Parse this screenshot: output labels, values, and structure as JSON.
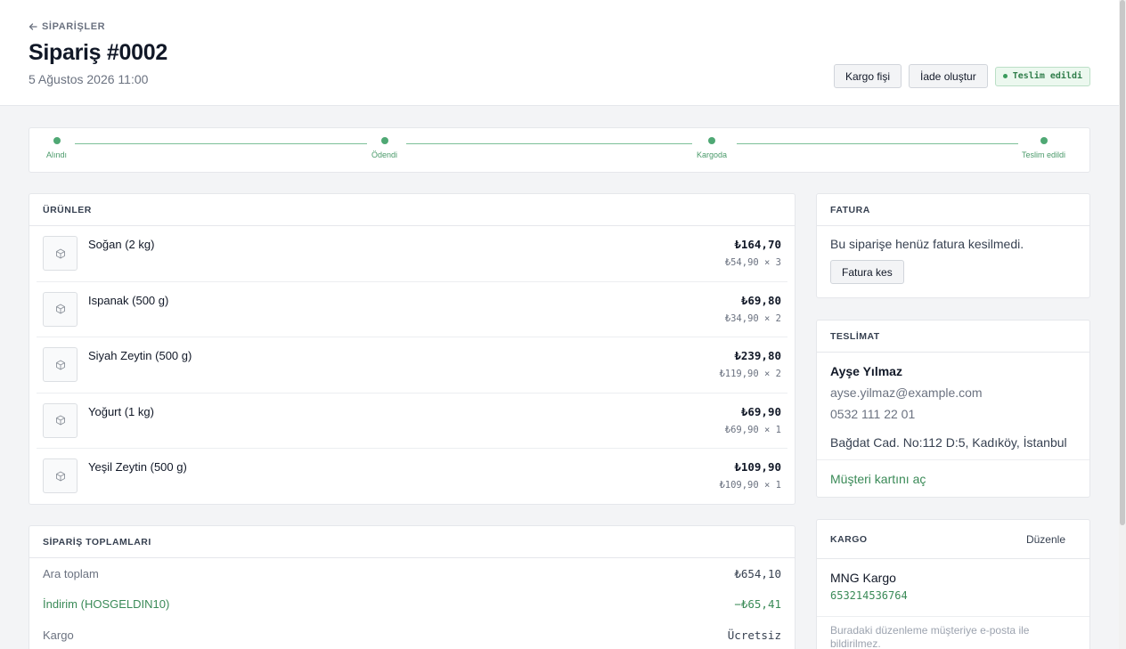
{
  "header": {
    "back_label": "SİPARİŞLER",
    "title": "Sipariş #0002",
    "date": "5 Ağustos 2026 11:00",
    "actions": {
      "shipping_slip": "Kargo fişi",
      "create_return": "İade oluştur"
    },
    "status": "Teslim edildi"
  },
  "progress": {
    "steps": [
      "Alındı",
      "Ödendi",
      "Kargoda",
      "Teslim edildi"
    ]
  },
  "products": {
    "heading": "ÜRÜNLER",
    "items": [
      {
        "name": "Soğan (2 kg)",
        "total": "₺164,70",
        "unit": "₺54,90 × 3"
      },
      {
        "name": "Ispanak (500 g)",
        "total": "₺69,80",
        "unit": "₺34,90 × 2"
      },
      {
        "name": "Siyah Zeytin (500 g)",
        "total": "₺239,80",
        "unit": "₺119,90 × 2"
      },
      {
        "name": "Yoğurt (1 kg)",
        "total": "₺69,90",
        "unit": "₺69,90 × 1"
      },
      {
        "name": "Yeşil Zeytin (500 g)",
        "total": "₺109,90",
        "unit": "₺109,90 × 1"
      }
    ]
  },
  "totals": {
    "heading": "SİPARİŞ TOPLAMLARI",
    "rows": [
      {
        "label": "Ara toplam",
        "value": "₺654,10"
      },
      {
        "label": "İndirim (HOSGELDIN10)",
        "value": "−₺65,41"
      },
      {
        "label": "Kargo",
        "value": "Ücretsiz"
      }
    ]
  },
  "invoice": {
    "heading": "FATURA",
    "message": "Bu siparişe henüz fatura kesilmedi.",
    "button": "Fatura kes"
  },
  "delivery": {
    "heading": "TESLİMAT",
    "name": "Ayşe Yılmaz",
    "email": "ayse.yilmaz@example.com",
    "phone": "0532 111 22 01",
    "address": "Bağdat Cad. No:112 D:5, Kadıköy, İstanbul",
    "link": "Müşteri kartını aç"
  },
  "shipping": {
    "heading": "KARGO",
    "edit": "Düzenle",
    "carrier": "MNG Kargo",
    "tracking": "653214536764",
    "note": "Buradaki düzenleme müşteriye e-posta ile bildirilmez."
  }
}
